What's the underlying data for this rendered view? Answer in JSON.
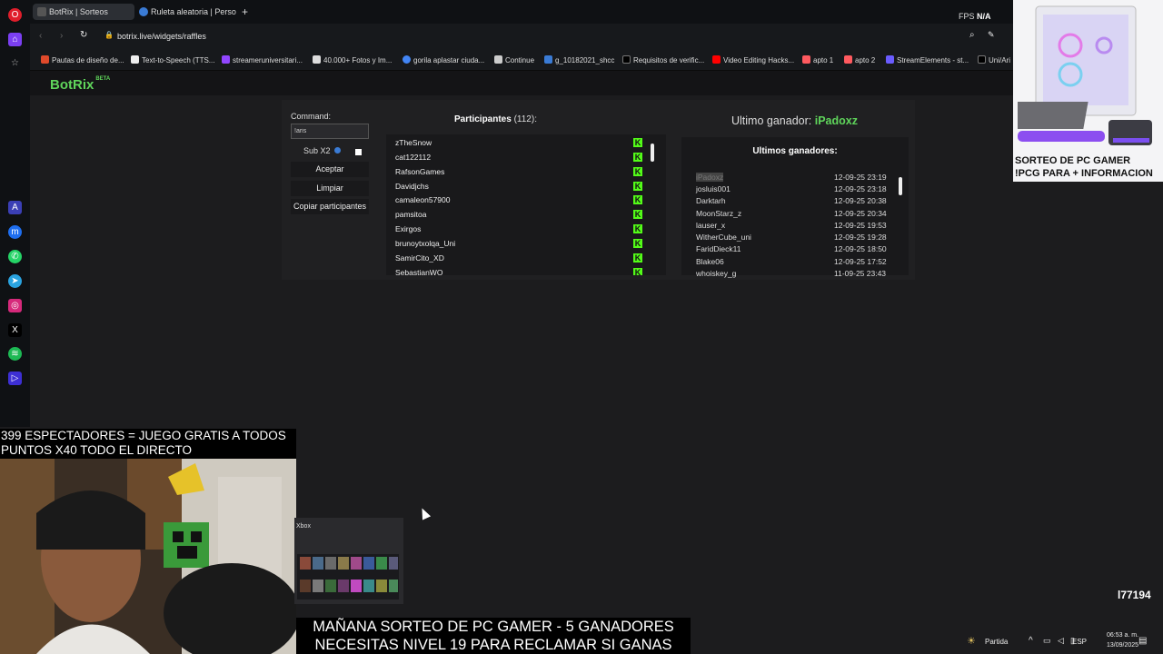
{
  "browser": {
    "tabs": [
      {
        "label": "BotRix | Sorteos",
        "active": true
      },
      {
        "label": "Ruleta aleatoria | Personali",
        "active": false
      }
    ],
    "url": "botrix.live/widgets/raffles",
    "bookmarks": [
      "Pautas de diseño de...",
      "Text-to-Speech (TTS...",
      "streameruniversitari...",
      "40.000+ Fotos y Im...",
      "gorila aplastar ciuda...",
      "Continue",
      "g_10182021_shcc",
      "Requisitos de verific...",
      "Video Editing Hacks...",
      "apto 1",
      "apto 2",
      "StreamElements - st...",
      "Uni/Ari"
    ]
  },
  "botrix": {
    "logo": "BotRix",
    "logo_badge": "BETA",
    "command_label": "Command:",
    "command_value": "!aris",
    "sub_label": "Sub X2",
    "buttons": {
      "accept": "Aceptar",
      "clear": "Limpiar",
      "copy": "Copiar participantes"
    },
    "participants_title": "Participantes",
    "participants_count": "(112):",
    "participants": [
      "zTheSnow",
      "cat122112",
      "RafsonGames",
      "Davidjchs",
      "camaleon57900",
      "pamsitoa",
      "Exirgos",
      "brunoytxolqa_Uni",
      "SamirCito_XD",
      "SebastianWO"
    ],
    "last_winner_label": "Ultimo ganador:",
    "last_winner": "iPadoxz",
    "winners_title": "Ultimos ganadores:",
    "winners": [
      {
        "name": "iPadoxz",
        "date": "12-09-25 23:19"
      },
      {
        "name": "josluis001",
        "date": "12-09-25 23:18"
      },
      {
        "name": "Darktarh",
        "date": "12-09-25 20:38"
      },
      {
        "name": "MoonStarz_z",
        "date": "12-09-25 20:34"
      },
      {
        "name": "lauser_x",
        "date": "12-09-25 19:53"
      },
      {
        "name": "WitherCube_uni",
        "date": "12-09-25 19:28"
      },
      {
        "name": "FaridDieck11",
        "date": "12-09-25 18:50"
      },
      {
        "name": "Blake06",
        "date": "12-09-25 17:52"
      },
      {
        "name": "whoiskey_g",
        "date": "11-09-25 23:43"
      }
    ]
  },
  "overlay": {
    "fps_label": "FPS",
    "fps_value": "N/A",
    "ad_line1": "SORTEO DE PC GAMER",
    "ad_line2": "!PCG PARA + INFORMACION",
    "viewers_line1": "399 ESPECTADORES = JUEGO GRATIS A TODOS",
    "viewers_line2": "PUNTOS X40 TODO EL DIRECTO",
    "bottom_line1": "MAÑANA SORTEO DE PC GAMER - 5 GANADORES",
    "bottom_line2": "NECESITAS NIVEL 19 PARA RECLAMAR SI GANAS",
    "xbox_label": "Xbox",
    "channel_tag": "l77194"
  },
  "taskbar": {
    "weather": "Partida",
    "lang": "ESP",
    "time": "06:53 a. m.",
    "date": "13/09/2025"
  },
  "colors": {
    "botrix_green": "#5fd55b",
    "kick_green": "#53fc18"
  }
}
